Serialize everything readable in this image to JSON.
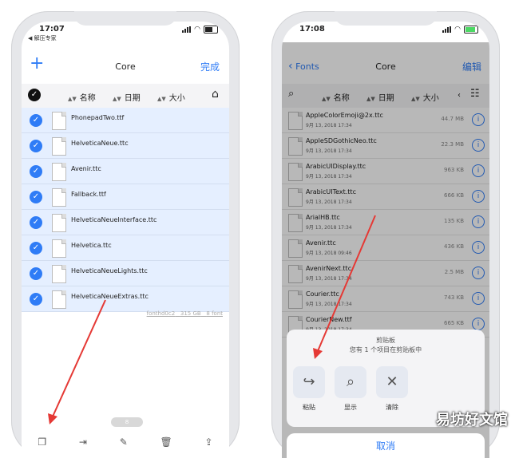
{
  "left": {
    "status": {
      "time": "17:07",
      "back_app": "◀ 解压专家"
    },
    "nav": {
      "add": "+",
      "title": "Core",
      "done": "完成"
    },
    "sort": {
      "name": "名称",
      "date": "日期",
      "size": "大小"
    },
    "files": [
      "PhonepadTwo.ttf",
      "HelveticaNeue.ttc",
      "Avenir.ttc",
      "Fallback.ttf",
      "HelveticaNeueInterface.ttc",
      "Helvetica.ttc",
      "HelveticaNeueLights.ttc",
      "HelveticaNeueExtras.ttc"
    ],
    "footer": [
      "fonthd0c2",
      "315 GB",
      "8 font"
    ],
    "pager": "8"
  },
  "right": {
    "status": {
      "time": "17:08"
    },
    "nav": {
      "back": "Fonts",
      "title": "Core",
      "edit": "编辑"
    },
    "sort": {
      "name": "名称",
      "date": "日期",
      "size": "大小"
    },
    "files": [
      {
        "name": "AppleColorEmoji@2x.ttc",
        "date": "9月 13, 2018 17:34",
        "size": "44.7 MB"
      },
      {
        "name": "AppleSDGothicNeo.ttc",
        "date": "9月 13, 2018 17:34",
        "size": "22.3 MB"
      },
      {
        "name": "ArabicUIDisplay.ttc",
        "date": "9月 13, 2018 17:34",
        "size": "963 KB"
      },
      {
        "name": "ArabicUIText.ttc",
        "date": "9月 13, 2018 17:34",
        "size": "666 KB"
      },
      {
        "name": "ArialHB.ttc",
        "date": "9月 13, 2018 17:34",
        "size": "135 KB"
      },
      {
        "name": "Avenir.ttc",
        "date": "9月 13, 2018 09:46",
        "size": "436 KB"
      },
      {
        "name": "AvenirNext.ttc",
        "date": "9月 13, 2018 17:34",
        "size": "2.5 MB"
      },
      {
        "name": "Courier.ttc",
        "date": "9月 13, 2018 17:34",
        "size": "743 KB"
      },
      {
        "name": "CourierNew.ttf",
        "date": "9月 13, 2018 17:34",
        "size": "665 KB"
      }
    ],
    "sheet": {
      "title": "剪贴板",
      "message": "您有 1 个项目在剪贴板中",
      "actions": [
        "粘贴",
        "显示",
        "清除"
      ],
      "cancel": "取消"
    }
  },
  "watermark": "易坊好文馆",
  "colors": {
    "accent": "#2f7cf6",
    "selected_row": "#e5efff",
    "arrow": "#e53935"
  }
}
